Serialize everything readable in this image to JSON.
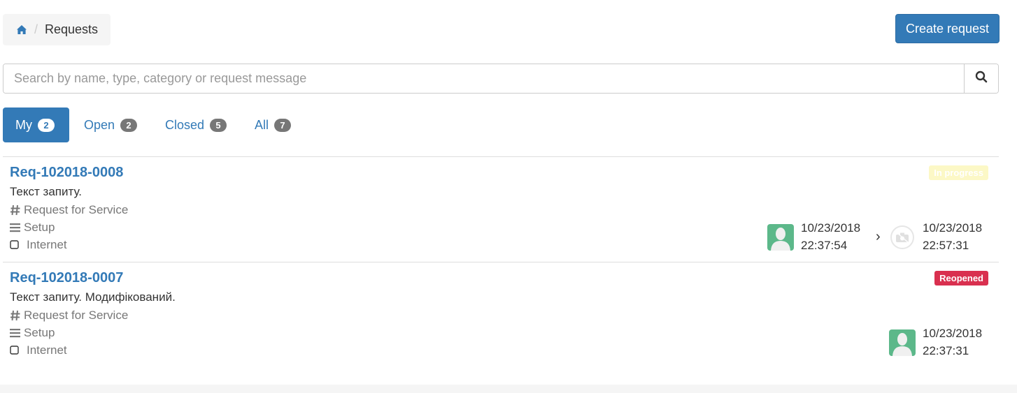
{
  "breadcrumb": {
    "home_icon": "home-icon",
    "current": "Requests"
  },
  "actions": {
    "create_label": "Create request"
  },
  "search": {
    "placeholder": "Search by name, type, category or request message",
    "value": ""
  },
  "tabs": [
    {
      "label": "My",
      "count": "2",
      "active": true
    },
    {
      "label": "Open",
      "count": "2",
      "active": false
    },
    {
      "label": "Closed",
      "count": "5",
      "active": false
    },
    {
      "label": "All",
      "count": "7",
      "active": false
    }
  ],
  "requests": [
    {
      "id": "Req-102018-0008",
      "message": "Текст запиту.",
      "type": "Request for Service",
      "category": "Setup",
      "subcategory": "Internet",
      "status": "In progress",
      "status_color": "#fcf8c6",
      "created_date": "10/23/2018",
      "created_time": "22:37:54",
      "updated_date": "10/23/2018",
      "updated_time": "22:57:31"
    },
    {
      "id": "Req-102018-0007",
      "message": "Текст запиту. Модифікований.",
      "type": "Request for Service",
      "category": "Setup",
      "subcategory": "Internet",
      "status": "Reopened",
      "status_color": "#d9304f",
      "created_date": "10/23/2018",
      "created_time": "22:37:31"
    }
  ],
  "colors": {
    "primary": "#337ab7",
    "avatar": "#5cb88a",
    "badge": "#777777"
  }
}
